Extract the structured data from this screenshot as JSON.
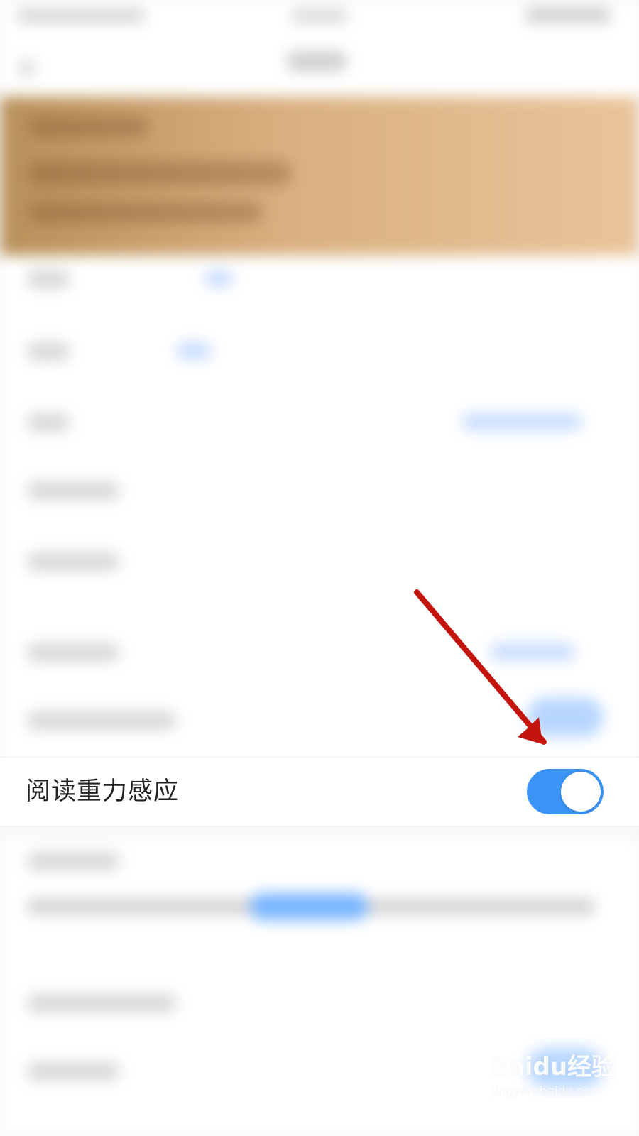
{
  "settings": {
    "highlighted_item": {
      "label": "阅读重力感应",
      "toggle_on": true
    }
  },
  "colors": {
    "toggle_on": "#3b93f6",
    "annotation_arrow": "#c4140e"
  },
  "watermark": {
    "title": "Baidu经验",
    "subtitle": "jingyan.baidu.com"
  }
}
